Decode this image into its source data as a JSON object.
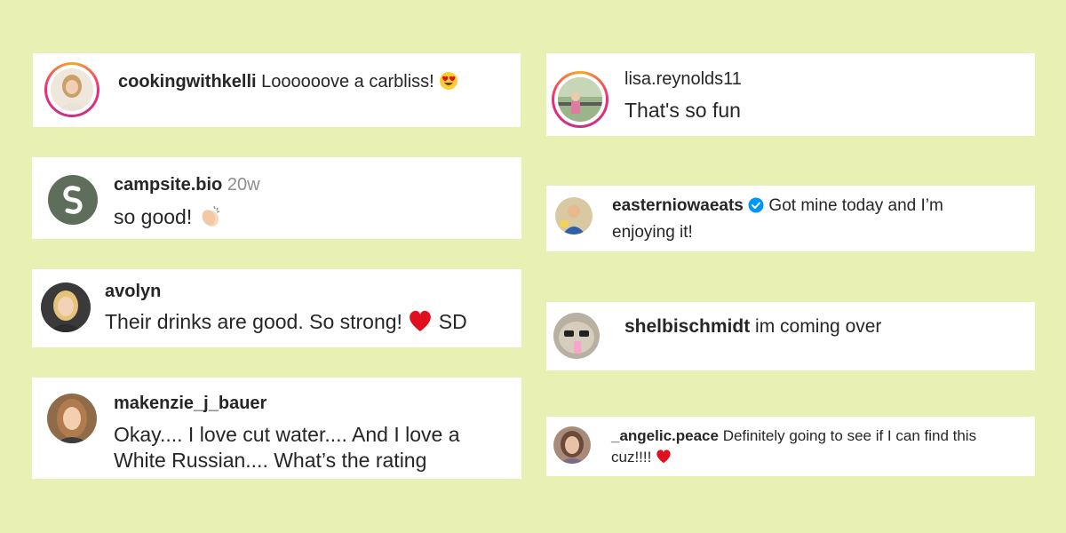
{
  "colors": {
    "background": "#e8f0b4",
    "card": "#ffffff",
    "text": "#262626",
    "meta": "#8e8e8e",
    "verified": "#0095f6",
    "heart": "#e0101e"
  },
  "comments": [
    {
      "username": "cookingwithkelli",
      "text": "Loooooove a carbliss!",
      "emoji": "heart-eyes-emoji"
    },
    {
      "username": "campsite.bio",
      "time": "20w",
      "text": "so good!",
      "emoji": "clapping-hands-emoji"
    },
    {
      "username": "avolyn",
      "text": "Their drinks are good. So strong!",
      "emoji": "red-heart-emoji",
      "suffix": "SD"
    },
    {
      "username": "makenzie_j_bauer",
      "text_line1": "Okay.... I love cut water.... And I love a",
      "text_line2": "White Russian.... What’s the rating"
    },
    {
      "username": "lisa.reynolds11",
      "text": "That's so fun"
    },
    {
      "username": "easterniowaeats",
      "verified": true,
      "text_line1": "Got mine today and I’m",
      "text_line2": "enjoying it!"
    },
    {
      "username": "shelbischmidt",
      "text": "im coming over"
    },
    {
      "username": "_angelic.peace",
      "text_line1": "Definitely going to see if I can find this",
      "text_line2": "cuz!!!!",
      "emoji": "red-heart-emoji"
    }
  ]
}
